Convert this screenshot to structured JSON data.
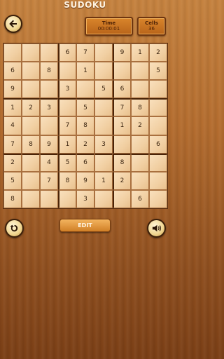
{
  "header": {
    "title": "SUDOKU"
  },
  "icons": {
    "back": "arrow-left-icon",
    "undo": "undo-icon",
    "sound": "speaker-icon"
  },
  "stats": {
    "time_label": "Time",
    "time_value": "00:00:01",
    "cells_label": "Cells",
    "cells_value": "36"
  },
  "board": [
    [
      "",
      "",
      "",
      "6",
      "7",
      "",
      "9",
      "1",
      "2"
    ],
    [
      "6",
      "",
      "8",
      "",
      "1",
      "",
      "",
      "",
      "5"
    ],
    [
      "9",
      "",
      "",
      "3",
      "",
      "5",
      "6",
      "",
      ""
    ],
    [
      "1",
      "2",
      "3",
      "",
      "5",
      "",
      "7",
      "8",
      ""
    ],
    [
      "4",
      "",
      "",
      "7",
      "8",
      "",
      "1",
      "2",
      ""
    ],
    [
      "7",
      "8",
      "9",
      "1",
      "2",
      "3",
      "",
      "",
      "6"
    ],
    [
      "2",
      "",
      "4",
      "5",
      "6",
      "",
      "8",
      "",
      ""
    ],
    [
      "5",
      "",
      "7",
      "8",
      "9",
      "1",
      "2",
      "",
      ""
    ],
    [
      "8",
      "",
      "",
      "",
      "3",
      "",
      "",
      "6",
      ""
    ]
  ],
  "controls": {
    "edit_label": "EDIT"
  },
  "colors": {
    "wood": "#b46d2f",
    "cell": "#f1cfa2",
    "button": "#d9852b"
  }
}
